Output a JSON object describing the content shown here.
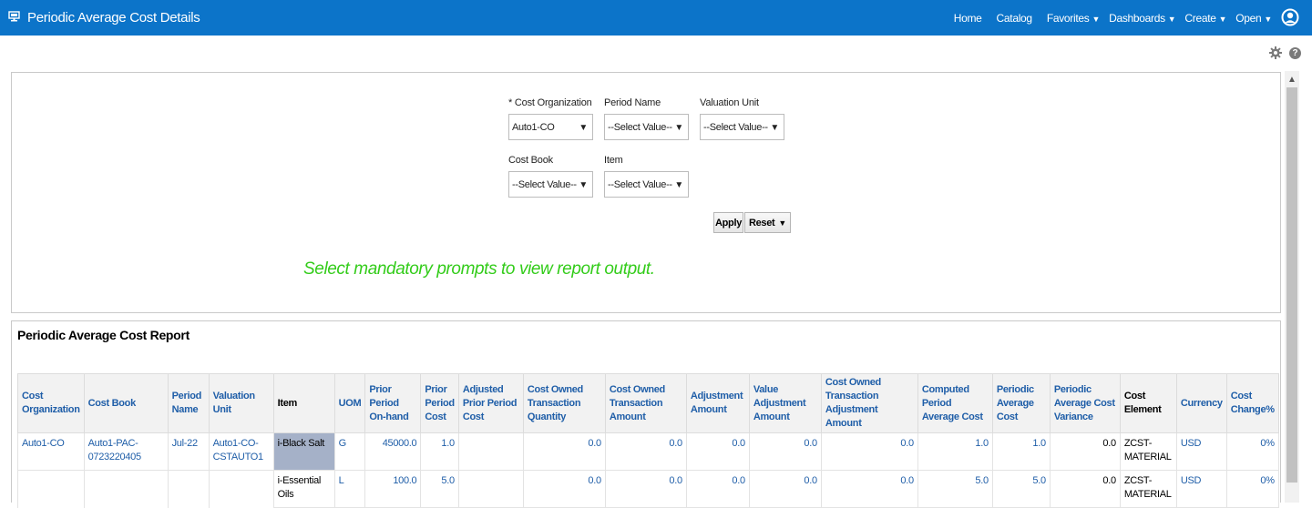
{
  "header": {
    "title": "Periodic Average Cost Details",
    "nav": {
      "home": "Home",
      "catalog": "Catalog",
      "favorites": "Favorites",
      "dashboards": "Dashboards",
      "create": "Create",
      "open": "Open"
    }
  },
  "prompts": {
    "cost_org": {
      "label": "* Cost Organization",
      "value": "Auto1-CO"
    },
    "period_name": {
      "label": "Period Name",
      "value": "--Select Value--"
    },
    "valuation_unit": {
      "label": "Valuation Unit",
      "value": "--Select Value--"
    },
    "cost_book": {
      "label": "Cost Book",
      "value": "--Select Value--"
    },
    "item": {
      "label": "Item",
      "value": "--Select Value--"
    },
    "apply_label": "Apply",
    "reset_label": "Reset",
    "message": "Select mandatory prompts to view report output."
  },
  "report": {
    "title": "Periodic Average Cost Report",
    "columns": [
      "Cost Organization",
      "Cost Book",
      "Period Name",
      "Valuation Unit",
      "Item",
      "UOM",
      "Prior Period On-hand",
      "Prior Period Cost",
      "Adjusted Prior Period Cost",
      "Cost Owned Transaction Quantity",
      "Cost Owned Transaction Amount",
      "Adjustment Amount",
      "Value Adjustment Amount",
      "Cost Owned Transaction Adjustment Amount",
      "Computed Period Average Cost",
      "Periodic Average Cost",
      "Periodic Average Cost Variance",
      "Cost Element",
      "Currency",
      "Cost Change%"
    ],
    "rows": [
      {
        "cost_org": "Auto1-CO",
        "cost_book": "Auto1-PAC-0723220405",
        "period": "Jul-22",
        "valuation_unit": "Auto1-CO-CSTAUTO1",
        "item": "i-Black Salt",
        "uom": "G",
        "prior_onhand": "45000.0",
        "prior_cost": "1.0",
        "adj_prior_cost": "",
        "txn_qty": "0.0",
        "txn_amt": "0.0",
        "adj_amt": "0.0",
        "value_adj_amt": "0.0",
        "txn_adj_amt": "0.0",
        "computed_avg": "1.0",
        "periodic_avg": "1.0",
        "variance": "0.0",
        "cost_element": "ZCST-MATERIAL",
        "currency": "USD",
        "change": "0%"
      },
      {
        "cost_org": "",
        "cost_book": "",
        "period": "",
        "valuation_unit": "",
        "item": "i-Essential Oils",
        "uom": "L",
        "prior_onhand": "100.0",
        "prior_cost": "5.0",
        "adj_prior_cost": "",
        "txn_qty": "0.0",
        "txn_amt": "0.0",
        "adj_amt": "0.0",
        "value_adj_amt": "0.0",
        "txn_adj_amt": "0.0",
        "computed_avg": "5.0",
        "periodic_avg": "5.0",
        "variance": "0.0",
        "cost_element": "ZCST-MATERIAL",
        "currency": "USD",
        "change": "0%"
      }
    ]
  },
  "colors": {
    "header_bg": "#0c74c9",
    "link": "#1f5ea8",
    "message": "#33cc1a",
    "highlight": "#a5b1c8"
  },
  "icons": [
    "monitor-icon",
    "user-icon",
    "gear-icon",
    "help-icon",
    "chevron-down-icon"
  ]
}
